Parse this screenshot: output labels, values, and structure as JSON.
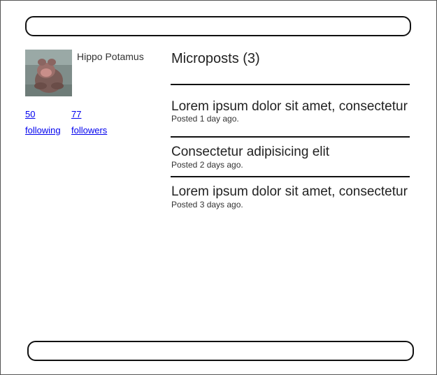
{
  "user": {
    "name": "Hippo Potamus"
  },
  "stats": {
    "following_count": "50",
    "following_label": "following",
    "followers_count": "77",
    "followers_label": "followers"
  },
  "microposts": {
    "heading": "Microposts (3)",
    "items": [
      {
        "content": "Lorem ipsum dolor sit amet, consectetur",
        "meta": "Posted 1 day ago."
      },
      {
        "content": "Consectetur adipisicing elit",
        "meta": "Posted 2 days ago."
      },
      {
        "content": "Lorem ipsum dolor sit amet, consectetur",
        "meta": "Posted 3 days ago."
      }
    ]
  },
  "icons": {
    "avatar": "hippo-photo"
  },
  "colors": {
    "link": "#0000ee",
    "border": "#111111"
  }
}
